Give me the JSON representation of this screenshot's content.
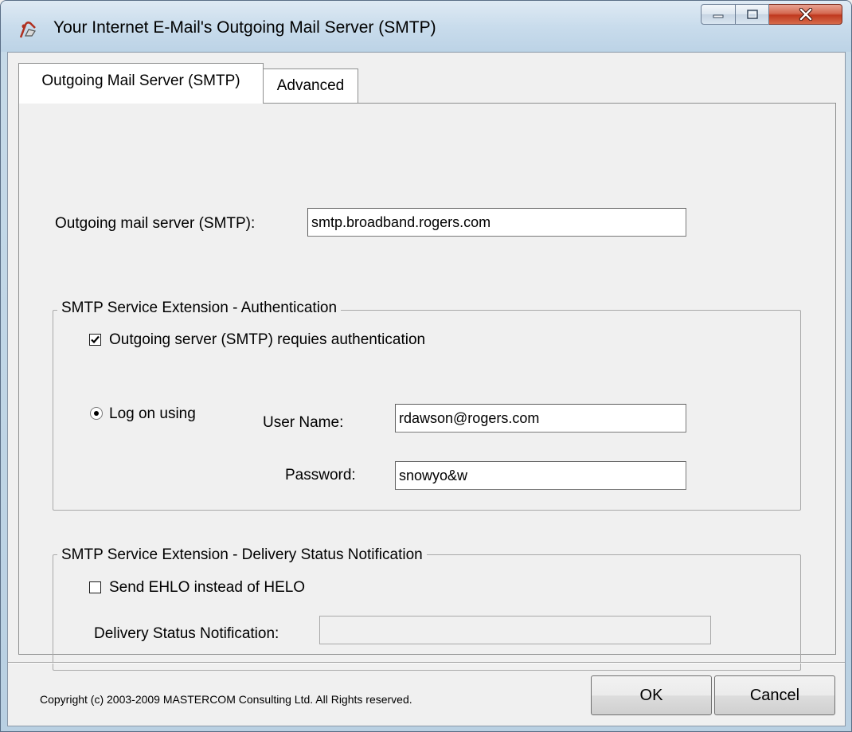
{
  "window": {
    "title": "Your Internet E-Mail's Outgoing Mail Server (SMTP)",
    "icon": "mail-server-icon"
  },
  "caption_buttons": {
    "minimize": "minimize-icon",
    "maximize": "maximize-icon",
    "close": "close-icon"
  },
  "tabs": [
    {
      "label": "Outgoing Mail Server (SMTP)",
      "active": true
    },
    {
      "label": "Advanced",
      "active": false
    }
  ],
  "server": {
    "label": "Outgoing mail server (SMTP):",
    "value": "smtp.broadband.rogers.com"
  },
  "auth_group": {
    "title": "SMTP Service Extension - Authentication",
    "requires_auth_label": "Outgoing server (SMTP) requies authentication",
    "requires_auth_checked": true,
    "logon_label": "Log on using",
    "logon_selected": true,
    "username_label": "User Name:",
    "username_value": "rdawson@rogers.com",
    "password_label": "Password:",
    "password_value": "snowyo&w"
  },
  "dsn_group": {
    "title": "SMTP Service Extension - Delivery Status Notification",
    "ehlo_label": "Send EHLO instead of HELO",
    "ehlo_checked": false,
    "dsn_label": "Delivery Status Notification:",
    "dsn_value": ""
  },
  "footer": {
    "copyright": "Copyright (c) 2003-2009 MASTERCOM Consulting Ltd. All Rights reserved.",
    "ok_label": "OK",
    "cancel_label": "Cancel"
  },
  "colors": {
    "close_button": "#c0391f",
    "window_frame": "#c7dbe9",
    "dialog_bg": "#f0f0f0"
  }
}
